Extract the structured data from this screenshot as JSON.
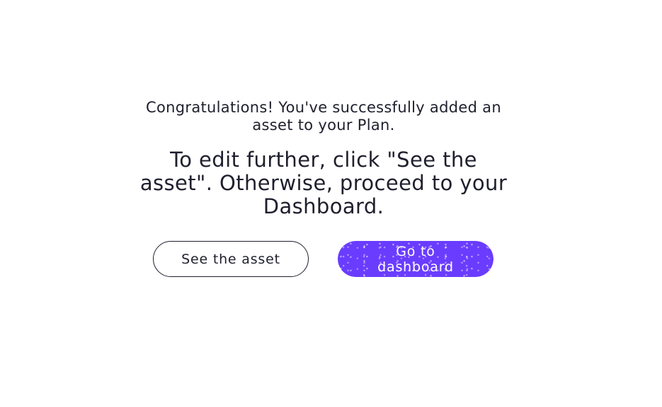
{
  "dialog": {
    "headline": "Congratulations! You've successfully added an asset to your Plan.",
    "instruction": "To edit further, click \"See the asset\". Otherwise, proceed to your Dashboard."
  },
  "actions": {
    "see_asset_label": "See the asset",
    "dashboard_label": "Go to dashboard"
  },
  "colors": {
    "accent": "#6a3cff",
    "text": "#1f1f2e",
    "background": "#ffffff"
  }
}
